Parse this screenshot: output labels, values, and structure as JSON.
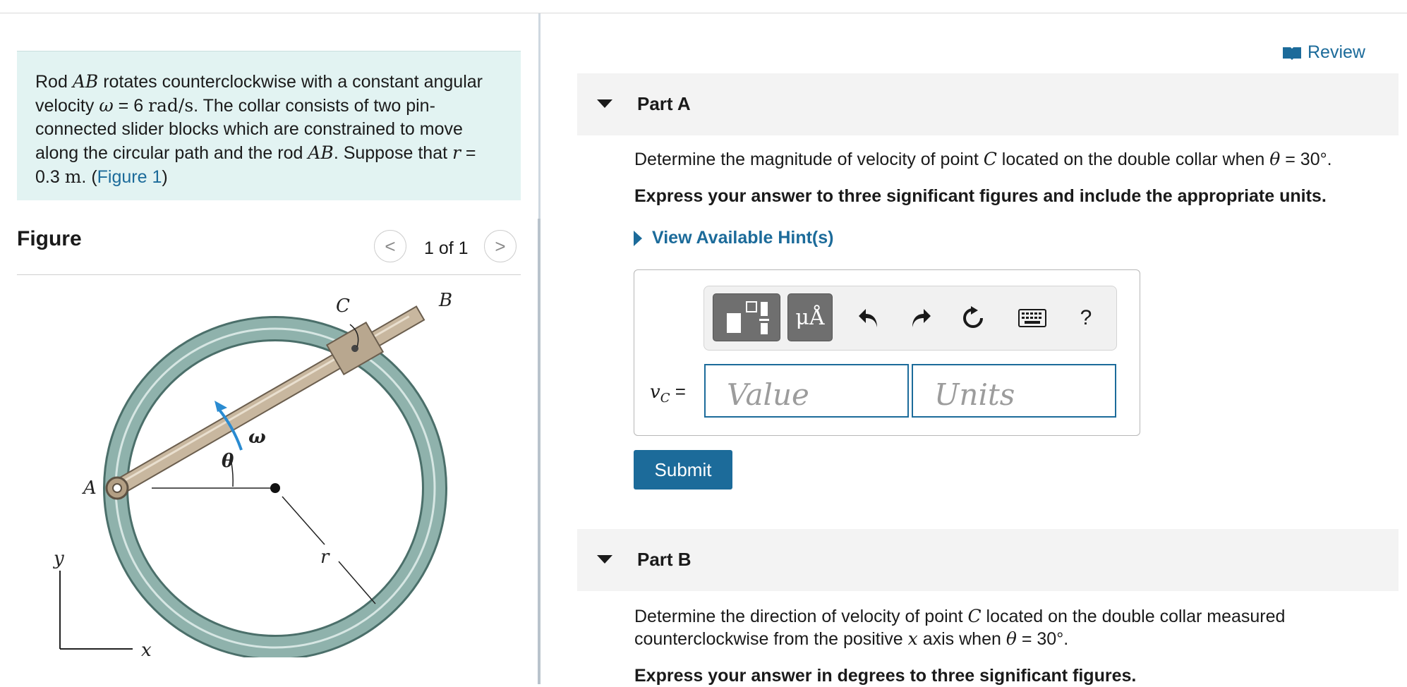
{
  "problem": {
    "t1": "Rod ",
    "rod": "AB",
    "t2": " rotates counterclockwise with a constant angular velocity ",
    "omega": "ω",
    "t3": " = 6 ",
    "omega_unit": "rad/s",
    "t4": ". The collar consists of two pin-connected slider blocks which are constrained to move along the circular path and the rod ",
    "rod2": "AB",
    "t5": ". Suppose that ",
    "r": "r",
    "t6": " = 0.3 ",
    "r_unit": "m",
    "t7": ". (",
    "figure_link": "Figure 1",
    "t8": ")"
  },
  "figure": {
    "title": "Figure",
    "nav_count": "1 of 1",
    "prev": "<",
    "next": ">",
    "labels": {
      "A": "A",
      "B": "B",
      "C": "C",
      "omega": "ω",
      "theta": "θ",
      "r": "r",
      "x": "x",
      "y": "y"
    }
  },
  "review": "Review",
  "partA": {
    "label": "Part A",
    "q1": "Determine the magnitude of velocity of point ",
    "q_point": "C",
    "q2": " located on the double collar when ",
    "q_theta": "θ",
    "q3": " = 30°.",
    "instruction": "Express your answer to three significant figures and include the appropriate units.",
    "hint": "View Available Hint(s)",
    "toolbar": {
      "mu": "μÅ",
      "help": "?"
    },
    "answer_label": {
      "v": "v",
      "sub": "C",
      "eq": " ="
    },
    "value_placeholder": "Value",
    "units_placeholder": "Units",
    "submit": "Submit"
  },
  "partB": {
    "label": "Part B",
    "q1": "Determine the direction of velocity of point ",
    "q_point": "C",
    "q2": " located on the double collar measured counterclockwise from the positive ",
    "q_axis": "x",
    "q3": " axis when ",
    "q_theta": "θ",
    "q4": " = 30°.",
    "instruction": "Express your answer in degrees to three significant figures."
  }
}
